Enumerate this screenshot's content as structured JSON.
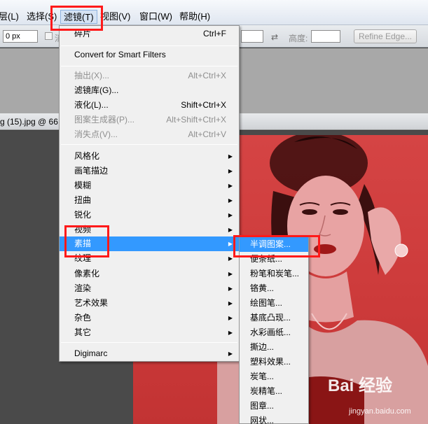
{
  "menubar": {
    "items": [
      {
        "label": "层(L)"
      },
      {
        "label": "选择(S)"
      },
      {
        "label": "滤镜(T)"
      },
      {
        "label": "视图(V)"
      },
      {
        "label": "窗口(W)"
      },
      {
        "label": "帮助(H)"
      }
    ]
  },
  "options": {
    "feather_value": "0 px",
    "partial_label": "消",
    "height_label": "高度:",
    "refine_edge": "Refine Edge..."
  },
  "document": {
    "tab_title": "g (15).jpg @ 66"
  },
  "filter_menu": {
    "items": [
      {
        "label": "碎片",
        "shortcut": "Ctrl+F"
      },
      {
        "label": "Convert for Smart Filters"
      },
      {
        "label": "抽出(X)...",
        "shortcut": "Alt+Ctrl+X"
      },
      {
        "label": "滤镜库(G)..."
      },
      {
        "label": "液化(L)...",
        "shortcut": "Shift+Ctrl+X"
      },
      {
        "label": "图案生成器(P)...",
        "shortcut": "Alt+Shift+Ctrl+X"
      },
      {
        "label": "消失点(V)...",
        "shortcut": "Alt+Ctrl+V"
      },
      {
        "label": "风格化"
      },
      {
        "label": "画笔描边"
      },
      {
        "label": "模糊"
      },
      {
        "label": "扭曲"
      },
      {
        "label": "锐化"
      },
      {
        "label": "视频"
      },
      {
        "label": "素描"
      },
      {
        "label": "纹理"
      },
      {
        "label": "像素化"
      },
      {
        "label": "渲染"
      },
      {
        "label": "艺术效果"
      },
      {
        "label": "杂色"
      },
      {
        "label": "其它"
      },
      {
        "label": "Digimarc"
      }
    ]
  },
  "sketch_submenu": {
    "items": [
      {
        "label": "半调图案..."
      },
      {
        "label": "便条纸..."
      },
      {
        "label": "粉笔和炭笔..."
      },
      {
        "label": "铬黄..."
      },
      {
        "label": "绘图笔..."
      },
      {
        "label": "基底凸现..."
      },
      {
        "label": "水彩画纸..."
      },
      {
        "label": "撕边..."
      },
      {
        "label": "塑料效果..."
      },
      {
        "label": "炭笔..."
      },
      {
        "label": "炭精笔..."
      },
      {
        "label": "图章..."
      },
      {
        "label": "网状..."
      }
    ]
  },
  "watermark": {
    "brand": "Bai 经验",
    "url": "jingyan.baidu.com"
  },
  "colors": {
    "highlight": "#3399ff",
    "annotation": "#ff1a1a",
    "photo_tint": "#d54444"
  }
}
